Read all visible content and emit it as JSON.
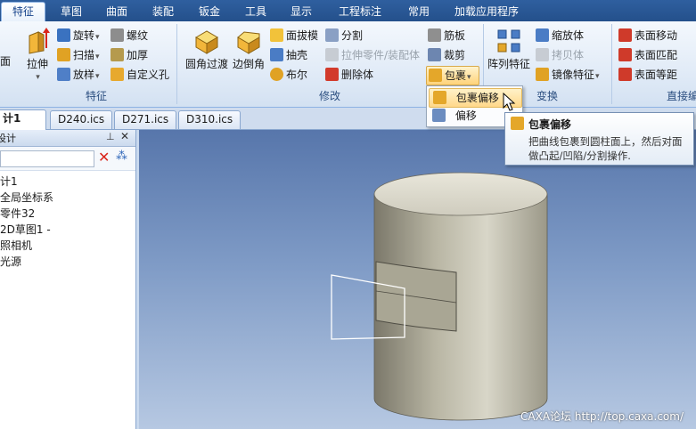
{
  "ribbon_tabs": [
    "特征",
    "草图",
    "曲面",
    "装配",
    "钣金",
    "工具",
    "显示",
    "工程标注",
    "常用",
    "加载应用程序"
  ],
  "active_tab": "特征",
  "ribbon": {
    "feature_group": {
      "label": "特征",
      "edge_button": "面",
      "extrude": "拉伸",
      "rotate": "旋转",
      "sweep": "扫描",
      "loft": "放样",
      "thread": "螺纹",
      "thicken": "加厚",
      "custom_hole": "自定义孔"
    },
    "modify_group": {
      "label": "修改",
      "fillet": "圆角过渡",
      "chamfer": "边倒角",
      "draft": "面拔模",
      "shell": "抽壳",
      "boolean": "布尔",
      "split": "分割",
      "extrude_part": "拉伸零件/装配体",
      "delete_body": "删除体",
      "rib": "筋板",
      "trim": "裁剪",
      "wrap": "包裹"
    },
    "transform_group": {
      "label": "变换",
      "array": "阵列特征",
      "scale": "缩放体",
      "copy": "拷贝体",
      "mirror": "镜像特征"
    },
    "direct_group": {
      "label": "直接编",
      "face_move": "表面移动",
      "face_match": "表面匹配",
      "face_offset": "表面等距"
    }
  },
  "dropdown": {
    "items": [
      "包裹偏移",
      "偏移"
    ]
  },
  "tooltip": {
    "title": "包裹偏移",
    "body": "把曲线包裹到圆柱面上，然后对面做凸起/凹陷/分割操作."
  },
  "doc_tabs": [
    "计1",
    "D240.ics",
    "D271.ics",
    "D310.ics"
  ],
  "panel": {
    "title": "设计",
    "tree": [
      "计1",
      "全局坐标系",
      "零件32",
      "2D草图1 -",
      "照相机",
      "光源"
    ]
  },
  "watermark": "CAXA论坛  http://top.caxa.com/"
}
